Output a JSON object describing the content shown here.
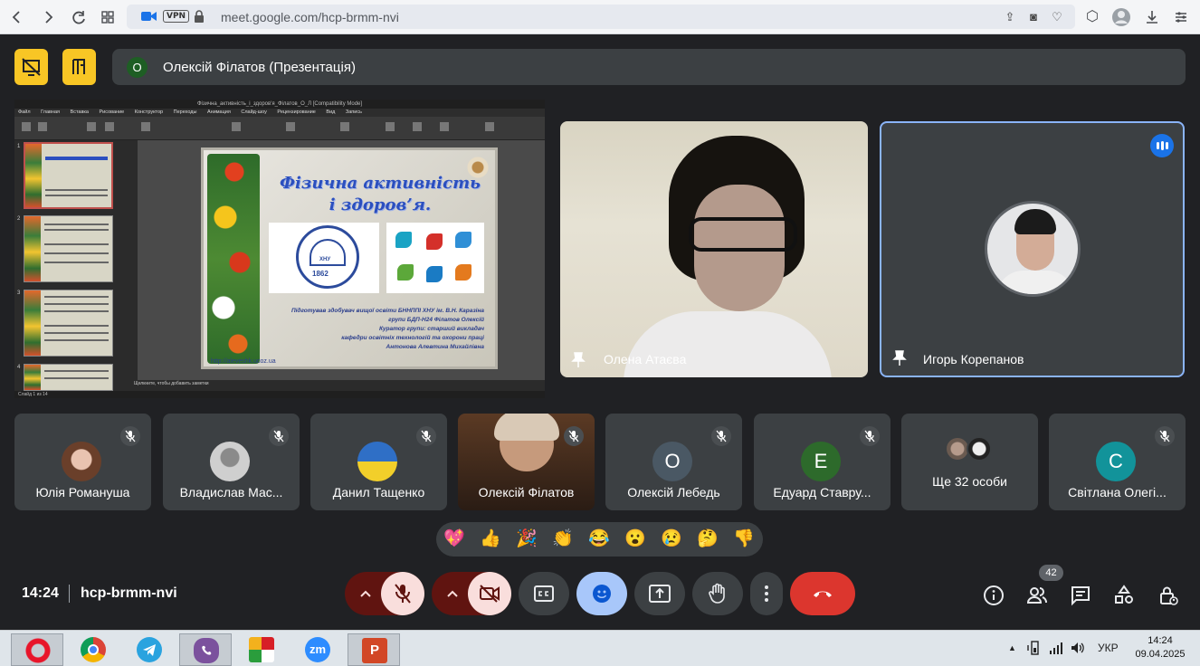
{
  "browser": {
    "url": "meet.google.com/hcp-brmm-nvi",
    "vpn_label": "VPN"
  },
  "meeting": {
    "presenter_initial": "О",
    "presenter_title": "Олексій Філатов (Презентація)",
    "time": "14:24",
    "code": "hcp-brmm-nvi",
    "participants_count": "42"
  },
  "slide": {
    "title_line1": "Фізична активність",
    "title_line2": "і здоров’я.",
    "logo_year": "1862",
    "logo_badge": "ХНУ",
    "text_lines": [
      "Підготував здобувач вищої освіти БННППІ ХНУ ім. В.Н. Каразіна",
      "групи БДП-Н24 Філатов Олексій",
      "Куратор групи: старший викладач",
      "кафедри освітніх технологій та охорони праці",
      "Антонова Алевтина Михайлівна"
    ],
    "url": "http://aleveshk.ucoz.ua",
    "notes": "Щелкните, чтобы добавить заметки",
    "tabs": [
      "Файл",
      "Главная",
      "Вставка",
      "Рисование",
      "Конструктор",
      "Переходы",
      "Анимация",
      "Слайд-шоу",
      "Рецензирование",
      "Вид",
      "Запись"
    ],
    "window_title": "Фізична_активність_і_здоров'я_Філатов_О_Л [Compatibility Mode]",
    "status": "Слайд 1 из 14"
  },
  "tiles": {
    "main": [
      {
        "name": "Олена Атаєва"
      },
      {
        "name": "Игорь Корепанов"
      }
    ],
    "small": [
      {
        "name": "Юлія Романуша",
        "initial": ""
      },
      {
        "name": "Владислав Мас...",
        "initial": ""
      },
      {
        "name": "Данил Тащенко",
        "initial": ""
      },
      {
        "name": "Олексій Філатов",
        "initial": ""
      },
      {
        "name": "Олексій Лебедь",
        "initial": "О",
        "color": "#4a5864"
      },
      {
        "name": "Едуард Ставру...",
        "initial": "Е",
        "color": "#2d6a2b"
      },
      {
        "name": "Ще 32 особи",
        "initial": ""
      },
      {
        "name": "Світлана Олегі...",
        "initial": "С",
        "color": "#12939a"
      }
    ]
  },
  "reactions": [
    "💖",
    "👍",
    "🎉",
    "👏",
    "😂",
    "😮",
    "😢",
    "🤔",
    "👎"
  ],
  "colors": {
    "background": "#202124",
    "tile": "#3c4043",
    "accent_blue": "#8ab4f8",
    "end_call": "#ea4335",
    "warning_yellow": "#f8c625"
  },
  "taskbar": {
    "lang": "УКР",
    "time": "14:24",
    "date": "09.04.2025"
  }
}
